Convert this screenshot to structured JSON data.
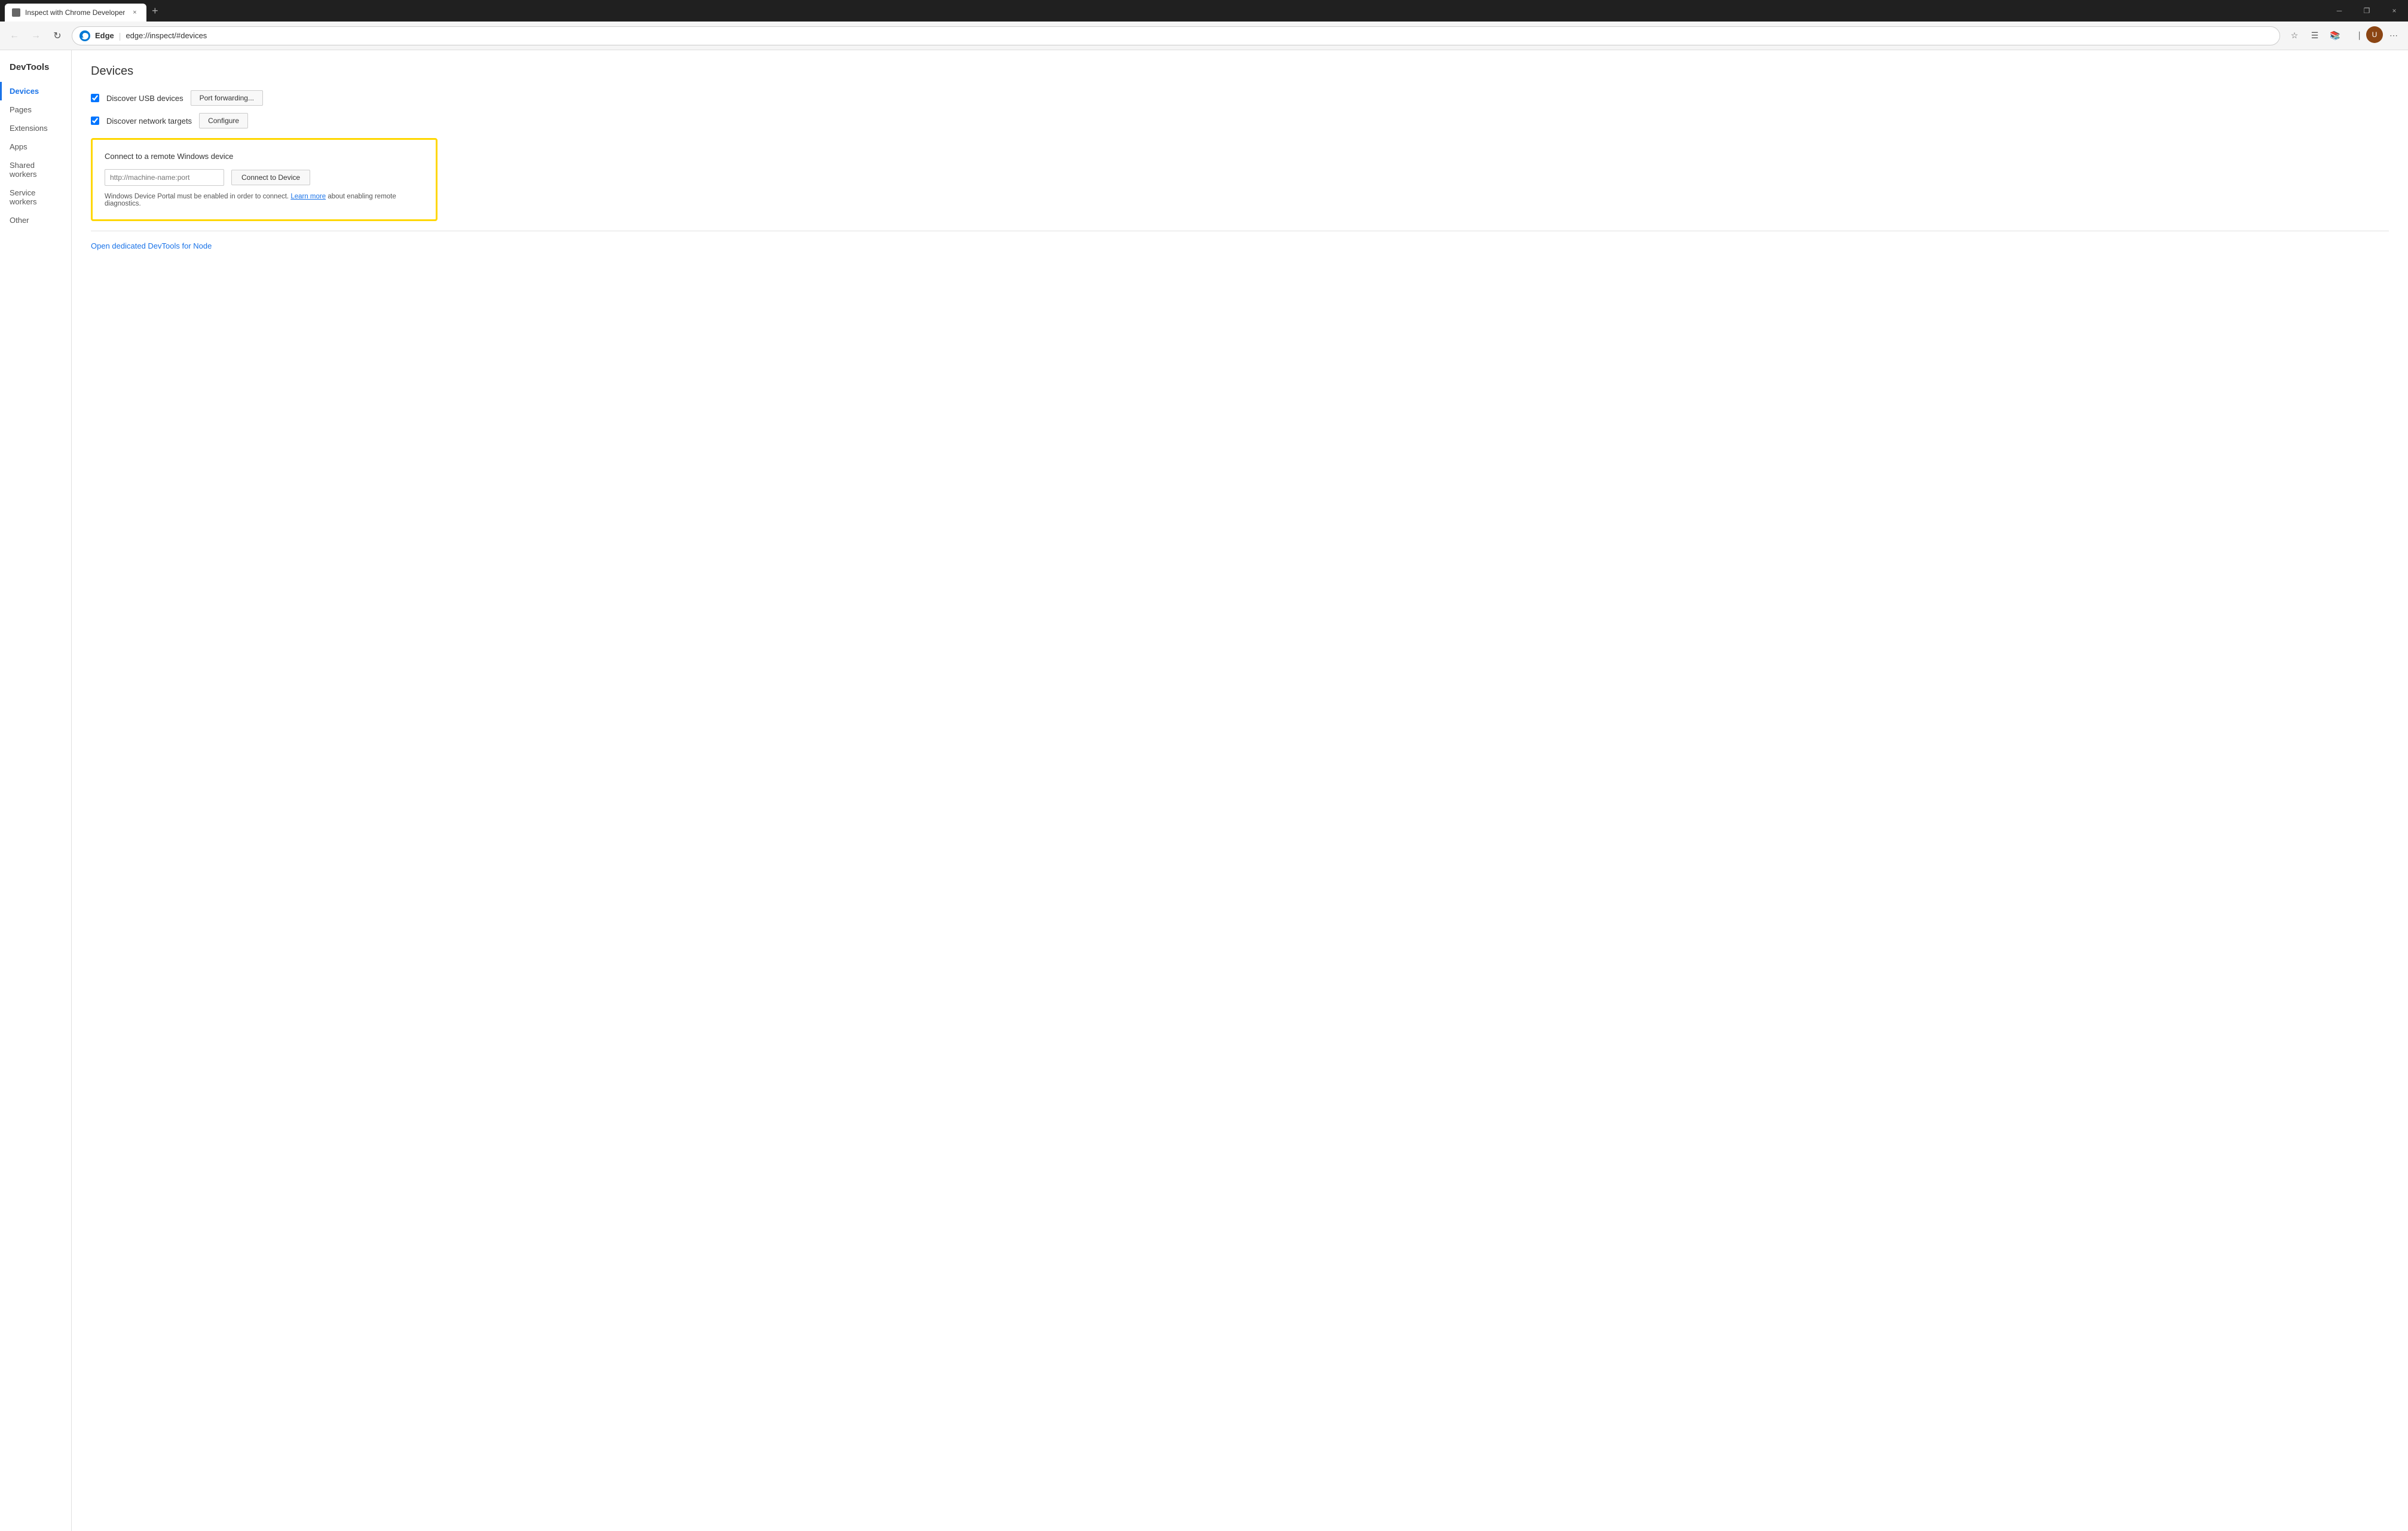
{
  "titlebar": {
    "tab_title": "Inspect with Chrome Developer",
    "close_label": "×",
    "new_tab_label": "+",
    "minimize_label": "─",
    "maximize_label": "❐",
    "window_close_label": "×"
  },
  "toolbar": {
    "brand": "Edge",
    "url": "edge://inspect/#devices",
    "separator": "|"
  },
  "devtools": {
    "logo": "DevTools",
    "nav_items": [
      {
        "id": "devices",
        "label": "Devices",
        "active": true
      },
      {
        "id": "pages",
        "label": "Pages",
        "active": false
      },
      {
        "id": "extensions",
        "label": "Extensions",
        "active": false
      },
      {
        "id": "apps",
        "label": "Apps",
        "active": false
      },
      {
        "id": "shared-workers",
        "label": "Shared workers",
        "active": false
      },
      {
        "id": "service-workers",
        "label": "Service workers",
        "active": false
      },
      {
        "id": "other",
        "label": "Other",
        "active": false
      }
    ]
  },
  "main": {
    "page_title": "Devices",
    "discover_usb_label": "Discover USB devices",
    "discover_network_label": "Discover network targets",
    "port_forwarding_btn": "Port forwarding...",
    "configure_btn": "Configure",
    "connect_section": {
      "title": "Connect to a remote Windows device",
      "input_placeholder": "http://machine-name:port",
      "connect_btn": "Connect to Device",
      "help_text": "Windows Device Portal must be enabled in order to connect.",
      "learn_more": "Learn more",
      "learn_more_suffix": " about enabling remote diagnostics."
    },
    "node_link": "Open dedicated DevTools for Node"
  }
}
